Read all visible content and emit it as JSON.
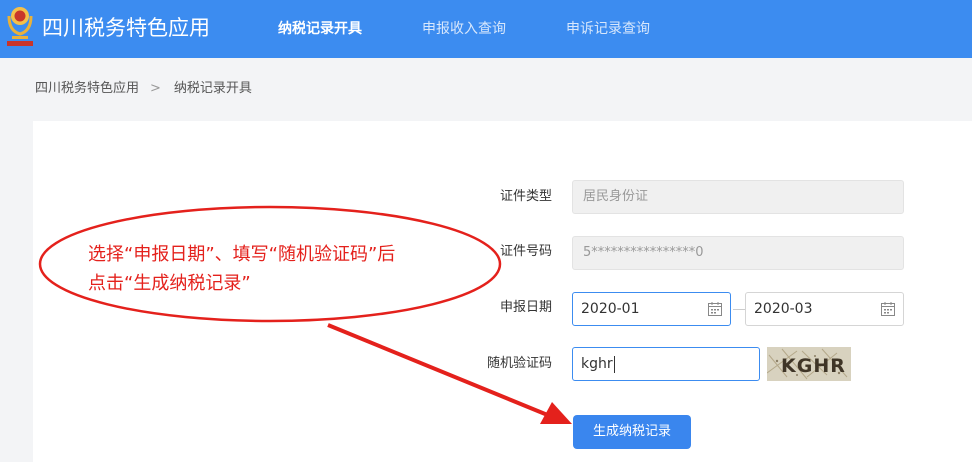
{
  "header": {
    "app_title": "四川税务特色应用",
    "nav": [
      {
        "label": "纳税记录开具",
        "active": true
      },
      {
        "label": "申报收入查询",
        "active": false
      },
      {
        "label": "申诉记录查询",
        "active": false
      }
    ]
  },
  "breadcrumb": {
    "home": "四川税务特色应用",
    "separator": ">",
    "current": "纳税记录开具"
  },
  "form": {
    "id_type_label": "证件类型",
    "id_type_value": "居民身份证",
    "id_number_label": "证件号码",
    "id_number_value": "5****************0",
    "period_label": "申报日期",
    "period_start": "2020-01",
    "period_end": "2020-03",
    "captcha_label": "随机验证码",
    "captcha_value": "kghr",
    "captcha_image_text": "KGHR",
    "submit_label": "生成纳税记录"
  },
  "annotation": {
    "line1": "选择“申报日期”、填写“随机验证码”后",
    "line2": "点击“生成纳税记录”",
    "color": "#e4211c"
  },
  "colors": {
    "header_bg": "#3c8cf0",
    "button_bg": "#3a86ee",
    "annotation": "#e4211c"
  }
}
